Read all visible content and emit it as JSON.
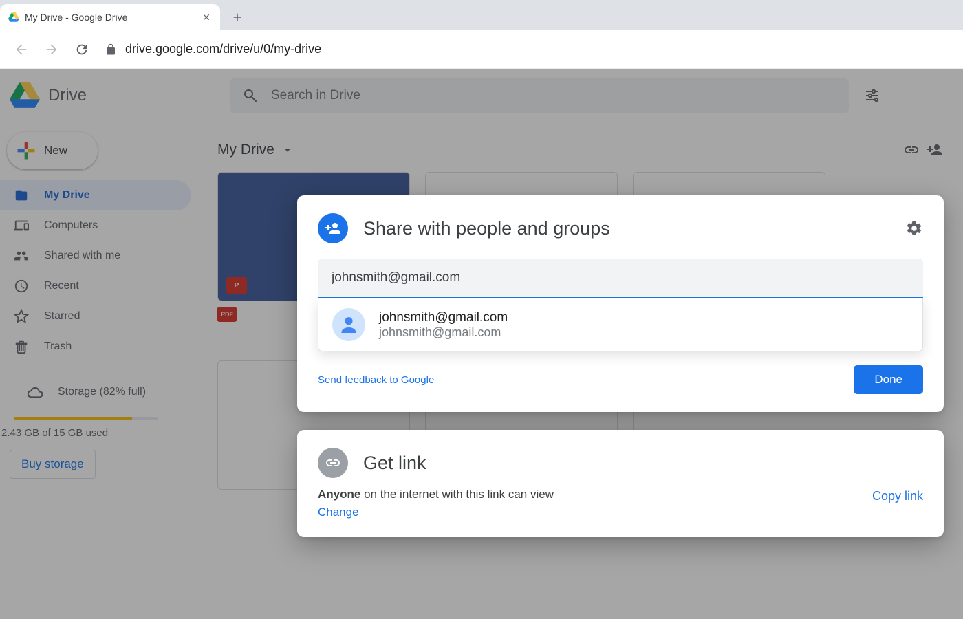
{
  "browser": {
    "tab_title": "My Drive - Google Drive",
    "url": "drive.google.com/drive/u/0/my-drive"
  },
  "drive": {
    "app_name": "Drive",
    "search_placeholder": "Search in Drive",
    "new_button": "New",
    "sidebar": [
      {
        "id": "my-drive",
        "label": "My Drive",
        "icon": "drive",
        "active": true
      },
      {
        "id": "computers",
        "label": "Computers",
        "icon": "devices",
        "active": false
      },
      {
        "id": "shared",
        "label": "Shared with me",
        "icon": "people",
        "active": false
      },
      {
        "id": "recent",
        "label": "Recent",
        "icon": "clock",
        "active": false
      },
      {
        "id": "starred",
        "label": "Starred",
        "icon": "star",
        "active": false
      },
      {
        "id": "trash",
        "label": "Trash",
        "icon": "trash",
        "active": false
      }
    ],
    "storage": {
      "line": "Storage (82% full)",
      "percent": 82,
      "used_line": "2.43 GB of 15 GB used",
      "buy": "Buy storage"
    },
    "breadcrumb": "My Drive"
  },
  "share_dialog": {
    "title": "Share with people and groups",
    "input_value": "johnsmith@gmail.com",
    "suggestion": {
      "name": "johnsmith@gmail.com",
      "email": "johnsmith@gmail.com"
    },
    "feedback": "Send feedback to Google",
    "done": "Done"
  },
  "link_dialog": {
    "title": "Get link",
    "anyone_strong": "Anyone",
    "anyone_rest": " on the internet with this link can view",
    "change": "Change",
    "copy": "Copy link"
  }
}
